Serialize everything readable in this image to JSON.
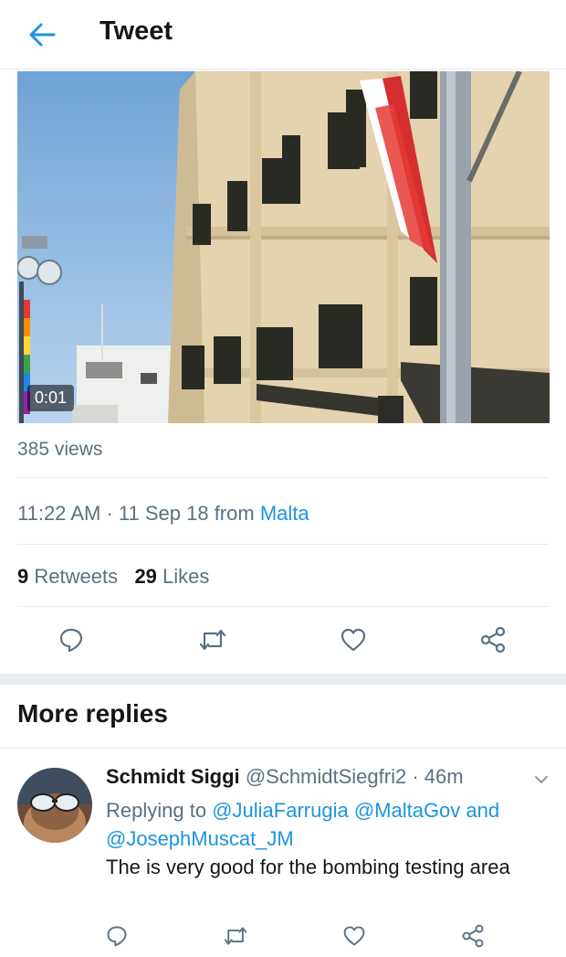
{
  "header": {
    "title": "Tweet",
    "back_icon": "arrow-left-icon"
  },
  "video": {
    "timecode": "0:01"
  },
  "tweet": {
    "views": "385 views",
    "time": "11:22 AM",
    "separator": " · ",
    "date": "11 Sep 18",
    "from_label": " from ",
    "location": "Malta",
    "retweets_count": "9",
    "retweets_label": "Retweets",
    "likes_count": "29",
    "likes_label": "Likes"
  },
  "actions": [
    {
      "name": "reply",
      "icon": "reply-icon"
    },
    {
      "name": "retweet",
      "icon": "retweet-icon"
    },
    {
      "name": "like",
      "icon": "heart-icon"
    },
    {
      "name": "share",
      "icon": "share-icon"
    }
  ],
  "more_replies": {
    "title": "More replies",
    "reply": {
      "name": "Schmidt Siggi",
      "handle": "@SchmidtSiegfri2",
      "time": "46m",
      "replying_prefix": "Replying to ",
      "mention_1": "@JuliaFarrugia",
      "mention_2": "@MaltaGov",
      "and": " and ",
      "mention_3": "@JosephMuscat_JM",
      "text": "The is very good for the bombing testing area"
    }
  },
  "colors": {
    "accent": "#1b95e0",
    "muted": "#5b7083",
    "divider": "#e6ecf0",
    "text": "#14171a"
  }
}
